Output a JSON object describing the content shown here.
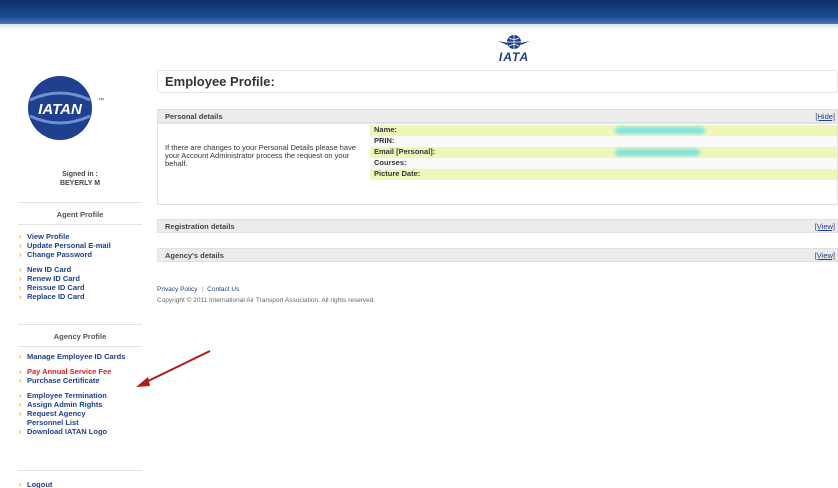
{
  "header": {
    "iata_label": "IATA"
  },
  "sidebar": {
    "logo_text": "IATAN",
    "signed_in_label": "Signed in :",
    "signed_in_name": "BEYERLY M",
    "agent_profile": {
      "title": "Agent Profile",
      "items": [
        {
          "label": "View Profile"
        },
        {
          "label": "Update Personal E-mail"
        },
        {
          "label": "Change Password"
        },
        {
          "label": "New ID Card"
        },
        {
          "label": "Renew ID Card"
        },
        {
          "label": "Reissue ID Card"
        },
        {
          "label": "Replace ID Card"
        }
      ]
    },
    "agency_profile": {
      "title": "Agency Profile",
      "items": [
        {
          "label": "Manage Employee ID Cards"
        },
        {
          "label": "Pay Annual Service Fee"
        },
        {
          "label": "Purchase Certificate"
        },
        {
          "label": "Employee Termination"
        },
        {
          "label": "Assign Admin Rights"
        },
        {
          "label": "Request Agency Personnel List"
        },
        {
          "label": "Download IATAN Logo"
        }
      ]
    },
    "logout_label": "Logout"
  },
  "main": {
    "title": "Employee Profile:",
    "personal": {
      "header": "Personal details",
      "toggle": "[Hide]",
      "note": "If there are changes to your Personal Details please have your Account Administrator process the request on your behalf.",
      "fields": [
        {
          "label": "Name:"
        },
        {
          "label": "PRIN:"
        },
        {
          "label": "Email [Personal]:"
        },
        {
          "label": "Courses:"
        },
        {
          "label": "Picture Date:"
        }
      ]
    },
    "registration": {
      "header": "Registration details",
      "toggle": "[View]"
    },
    "agency": {
      "header": "Agency's details",
      "toggle": "[View]"
    },
    "footer": {
      "privacy": "Privacy Policy",
      "contact": "Contact Us",
      "copyright": "Copyright © 2011 International Air Transport Association. All rights reserved."
    }
  },
  "colors": {
    "brand_blue": "#1e3f8c",
    "highlight_field": "#eef7b8",
    "alert_red": "#d42020",
    "arrow": "#b01c1c"
  }
}
